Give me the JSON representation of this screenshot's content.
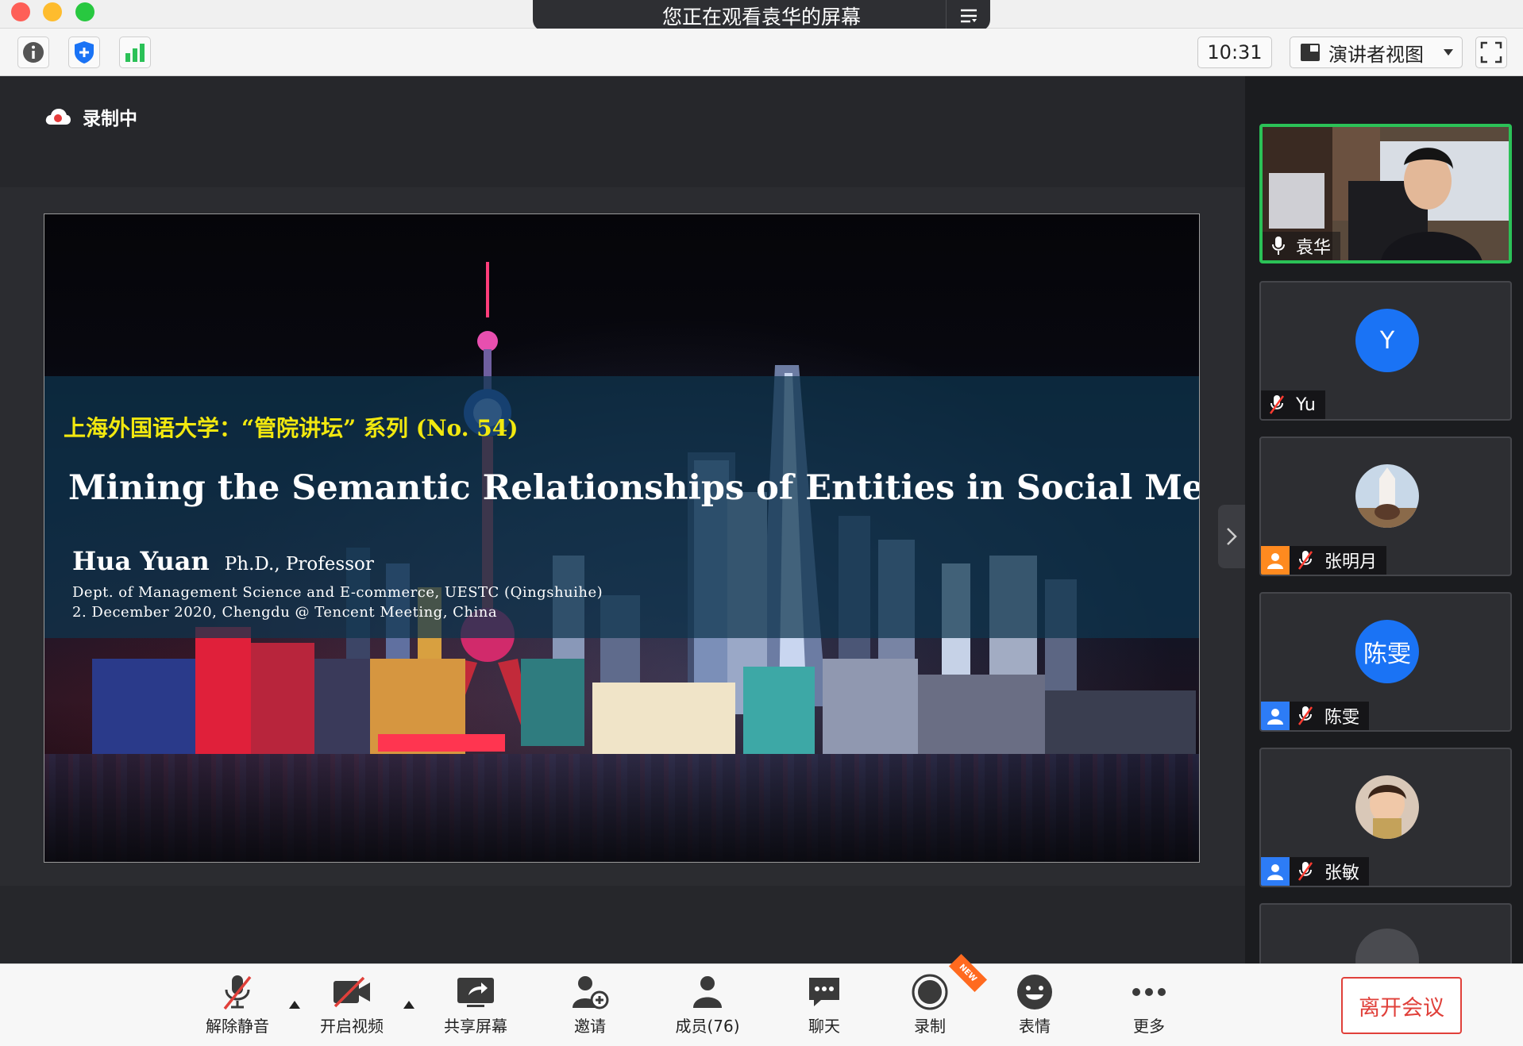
{
  "window": {
    "share_banner": "您正在观看袁华的屏幕",
    "traffic_colors": [
      "#fe5f57",
      "#febc2e",
      "#28c840"
    ]
  },
  "top_toolbar": {
    "time": "10:31",
    "view_mode": "演讲者视图",
    "icons": [
      "info-icon",
      "shield-icon",
      "signal-icon",
      "layout-icon",
      "fullscreen-icon"
    ]
  },
  "stage": {
    "recording_label": "录制中",
    "slide": {
      "series": "上海外国语大学：“管院讲坛” 系列 (No. 54)",
      "title": "Mining the Semantic Relationships of Entities in Social Media",
      "author_name": "Hua Yuan",
      "author_role": "Ph.D., Professor",
      "affiliation": "Dept. of Management Science and E-commerce, UESTC (Qingshuihe)",
      "date_line": "2. December 2020, Chengdu @ Tencent Meeting, China"
    }
  },
  "participants": [
    {
      "name": "袁华",
      "type": "video",
      "active": true
    },
    {
      "name": "Yu",
      "type": "initial",
      "initial": "Y",
      "avatar_color": "#1a73f5"
    },
    {
      "name": "张明月",
      "type": "photo",
      "role_color": "#ff8a1f"
    },
    {
      "name": "陈雯",
      "type": "initial",
      "initial": "陈雯",
      "avatar_color": "#1a73f5",
      "role_color": "#2d7cf6"
    },
    {
      "name": "张敏",
      "type": "photo",
      "role_color": "#2d7cf6"
    }
  ],
  "bottom_toolbar": {
    "unmute": "解除静音",
    "start_video": "开启视频",
    "share_screen": "共享屏幕",
    "invite": "邀请",
    "members": "成员(76)",
    "chat": "聊天",
    "record": "录制",
    "record_badge": "NEW",
    "reactions": "表情",
    "more": "更多",
    "leave": "离开会议"
  },
  "colors": {
    "accent_green": "#2bc157",
    "accent_blue": "#1a73f5",
    "leave_red": "#e0403a",
    "slide_series_yellow": "#f2e80f"
  }
}
